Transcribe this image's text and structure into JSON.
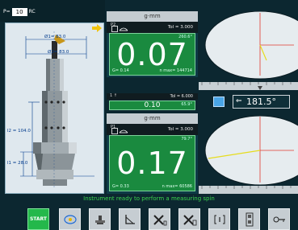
{
  "header": {
    "p_label": "P=",
    "p_value": "10",
    "p_unit": "RC"
  },
  "tool_panel": {
    "diameter1": "Ø1= 83.0",
    "diameter2": "Ø2= 83.0",
    "length2": "l2 = 104.0",
    "length1": "l1 = 28.0"
  },
  "panel_top": {
    "header": "g·mm",
    "plane": "P2",
    "tol": "Tol = 3.000",
    "value": "0.07",
    "angle": "260.6°",
    "g": "G= 0.14",
    "n_max": "n max= 144714"
  },
  "middle_row": {
    "label": "1 ↑",
    "tol": "Tol = 6.000",
    "value": "0.10",
    "angle": "65.9°"
  },
  "panel_bottom": {
    "header": "g·mm",
    "plane": "P1",
    "tol": "Tol = 3.000",
    "value": "0.17",
    "angle": "79.7°",
    "g": "G= 0.33",
    "n_max": "n max= 60586"
  },
  "angle_display": {
    "value": "181.5°",
    "arrow": "⇐"
  },
  "status_message": "Instrument ready to perform a measuring spin",
  "toolbar": {
    "start_label": "START",
    "buttons": [
      "target-icon",
      "balance-icon",
      "angle-icon",
      "tools-icon",
      "tools-plus-icon",
      "bracket-icon",
      "device-icon",
      "key-icon"
    ]
  },
  "colors": {
    "background": "#0c2730",
    "green_display": "#1a8a3f",
    "status_text": "#3bd64e",
    "start_button": "#24b84b",
    "vector_line": "#e6dc1e",
    "axis_line": "#e23a2f"
  }
}
